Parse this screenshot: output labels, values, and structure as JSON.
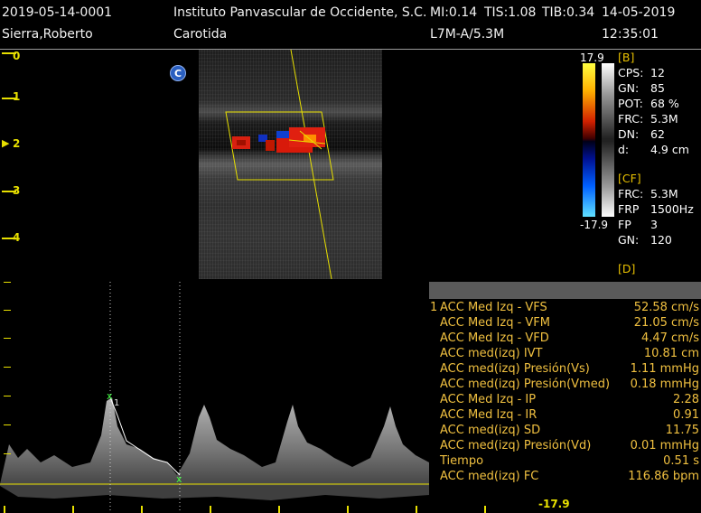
{
  "header": {
    "exam_id": "2019-05-14-0001",
    "institution": "Instituto Panvascular de Occidente, S.C.",
    "mi": "MI:0.14",
    "tis": "TIS:1.08",
    "tib": "TIB:0.34",
    "date": "14-05-2019",
    "patient": "Sierra,Roberto",
    "study": "Carotida",
    "probe": "L7M-A/5.3M",
    "time": "12:35:01"
  },
  "depth_scale": [
    "0",
    "1",
    "2",
    "3",
    "4"
  ],
  "mode_badge": "C",
  "color_scale": {
    "max": "17.9",
    "min": "-17.9"
  },
  "params": {
    "b_section": "[B]",
    "b": [
      {
        "label": "CPS:",
        "value": "12"
      },
      {
        "label": "GN:",
        "value": "85"
      },
      {
        "label": "POT:",
        "value": "68 %"
      },
      {
        "label": "FRC:",
        "value": "5.3M"
      },
      {
        "label": "DN:",
        "value": "62"
      },
      {
        "label": "d:",
        "value": "4.9 cm"
      }
    ],
    "cf_section": "[CF]",
    "cf": [
      {
        "label": "FRC:",
        "value": "5.3M"
      },
      {
        "label": "FRP",
        "value": "1500Hz"
      },
      {
        "label": "FP",
        "value": "3"
      },
      {
        "label": "GN:",
        "value": "120"
      }
    ],
    "d_section": "[D]"
  },
  "measurements": [
    {
      "num": "1",
      "label": "ACC  Med Izq - VFS",
      "value": "52.58 cm/s"
    },
    {
      "num": "",
      "label": "ACC Med Izq - VFM",
      "value": "21.05 cm/s"
    },
    {
      "num": "",
      "label": "ACC Med Izq - VFD",
      "value": "4.47 cm/s"
    },
    {
      "num": "",
      "label": "ACC med(izq) IVT",
      "value": "10.81 cm"
    },
    {
      "num": "",
      "label": "ACC med(izq) Presión(Vs)",
      "value": "1.11 mmHg"
    },
    {
      "num": "",
      "label": "ACC med(izq) Presión(Vmed)",
      "value": "0.18 mmHg"
    },
    {
      "num": "",
      "label": "ACC Med Izq - IP",
      "value": "2.28"
    },
    {
      "num": "",
      "label": "ACC Med Izq - IR",
      "value": "0.91"
    },
    {
      "num": "",
      "label": "ACC med(izq) SD",
      "value": "11.75"
    },
    {
      "num": "",
      "label": "ACC med(izq) Presión(Vd)",
      "value": "0.01 mmHg"
    },
    {
      "num": "",
      "label": "Tiempo",
      "value": "0.51 s"
    },
    {
      "num": "",
      "label": "ACC med(izq) FC",
      "value": "116.86 bpm"
    }
  ],
  "doppler": {
    "cursor_label": "1",
    "velocity_min_label": "-17.9"
  },
  "colors": {
    "accent_yellow": "#e8e000",
    "measure_text": "#f0c040",
    "cursor_green": "#40ff40"
  }
}
